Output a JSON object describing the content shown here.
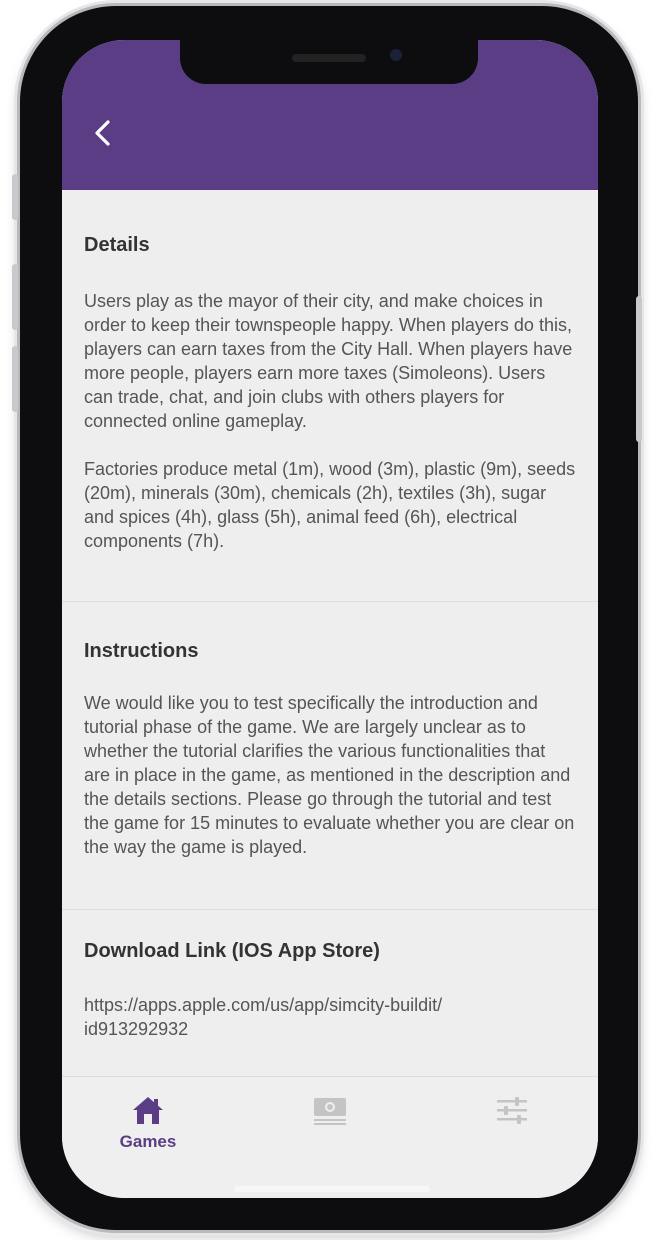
{
  "header": {
    "back_icon": "chevron-left-icon",
    "accent_color": "#5b3d86"
  },
  "details": {
    "title": "Details",
    "paragraphs": [
      "Users play as the mayor of their city, and make choices in order to keep their townspeople happy. When players do this, players can earn taxes from the City Hall. When players have more people, players earn more taxes (Simoleons). Users can trade, chat, and join clubs with others players for connected online gameplay.",
      "Factories produce metal (1m), wood (3m), plastic (9m), seeds (20m), minerals (30m), chemicals (2h), textiles (3h), sugar and spices (4h), glass (5h), animal feed (6h), electrical components (7h)."
    ]
  },
  "instructions": {
    "title": "Instructions",
    "text": "We would like you to test specifically the introduction and tutorial phase of the game. We are largely unclear as to whether the tutorial clarifies the various functionalities that are in place in the game, as mentioned in the description and the details sections. Please go through the tutorial and test the game for 15 minutes to evaluate whether you are clear on the way the game is played."
  },
  "download": {
    "title": "Download Link (IOS App Store)",
    "link_line1": "https://apps.apple.com/us/app/simcity-buildit/",
    "link_line2": "id913292932"
  },
  "tabbar": {
    "tabs": [
      {
        "label": "Games",
        "icon": "home-icon",
        "active": true
      },
      {
        "label": "",
        "icon": "money-icon",
        "active": false
      },
      {
        "label": "",
        "icon": "sliders-icon",
        "active": false
      }
    ],
    "active_color": "#5b3d86",
    "inactive_color": "#c4c4c4"
  }
}
